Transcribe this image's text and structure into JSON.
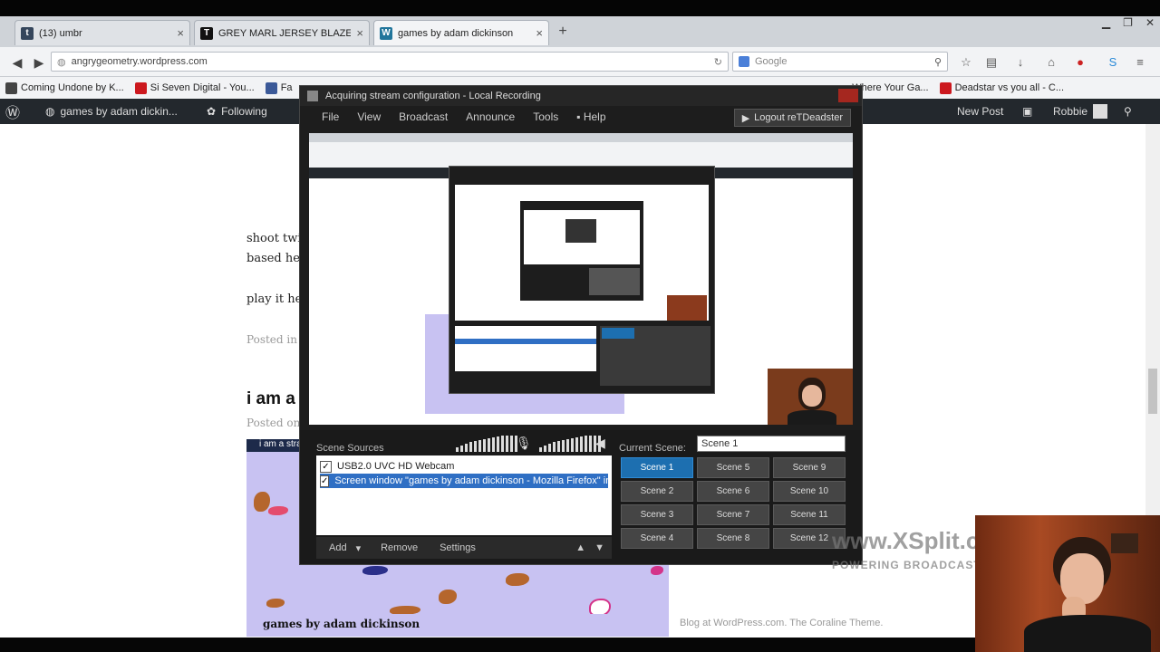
{
  "browser": {
    "tabs": [
      {
        "label": "(13) umbr",
        "favicon_color": "#35465c",
        "favicon_glyph": "t"
      },
      {
        "label": "GREY MARL JERSEY BLAZE...",
        "favicon_color": "#111111",
        "favicon_glyph": "T"
      },
      {
        "label": "games by adam dickinson",
        "favicon_color": "#21759b",
        "favicon_glyph": "W",
        "active": true
      }
    ],
    "new_tab_glyph": "+",
    "url": "angrygeometry.wordpress.com",
    "search_placeholder": "Google",
    "bookmarks": [
      {
        "label": "Coming Undone by K...",
        "color": "#444444"
      },
      {
        "label": "Si Seven Digital - You...",
        "color": "#cc181e"
      },
      {
        "label": "Fa",
        "color": "#3b5998"
      },
      {
        "label": "ppr - Where Your Ga...",
        "color": "#333333"
      },
      {
        "label": "Deadstar vs you all - C...",
        "color": "#cc181e"
      }
    ]
  },
  "wordpress": {
    "site_name": "games by adam dickin...",
    "following": "Following",
    "new_post": "New Post",
    "user": "Robbie"
  },
  "post": {
    "line1": "shoot twin",
    "line2": "based he",
    "line3": "play it he",
    "posted": "Posted in",
    "heading": "i am a",
    "posted2": "Posted on",
    "game_caption": "i am a stra",
    "site_footer_title": "games by adam dickinson",
    "footer_right": "Blog at WordPress.com. The Coraline Theme."
  },
  "xsplit": {
    "title": "Acquiring stream configuration - Local Recording",
    "menu": [
      "File",
      "View",
      "Broadcast",
      "Announce",
      "Tools",
      "Help"
    ],
    "logout": "Logout reTDeadster",
    "scene_sources_label": "Scene Sources",
    "sources": [
      {
        "label": "USB2.0 UVC HD Webcam",
        "checked": true,
        "selected": false
      },
      {
        "label": "Screen window \"games by adam dickinson - Mozilla Firefox\" in \"Fi...",
        "checked": true,
        "selected": true
      }
    ],
    "source_actions": [
      "Add",
      "Remove",
      "Settings"
    ],
    "current_scene_label": "Current Scene:",
    "current_scene_value": "Scene 1",
    "scenes": [
      "Scene 1",
      "Scene 5",
      "Scene 9",
      "Scene 2",
      "Scene 6",
      "Scene 10",
      "Scene 3",
      "Scene 7",
      "Scene 11",
      "Scene 4",
      "Scene 8",
      "Scene 12"
    ],
    "active_scene": "Scene 1"
  },
  "watermark": {
    "brand": "www.XSplit.com",
    "tagline": "POWERING BROADCASTING"
  },
  "colors": {
    "wp_admin_bar": "#23282d",
    "xsplit_bg": "#1d1d1d",
    "scene_active": "#1d6fb0",
    "game_bg": "#c8c2f2"
  }
}
